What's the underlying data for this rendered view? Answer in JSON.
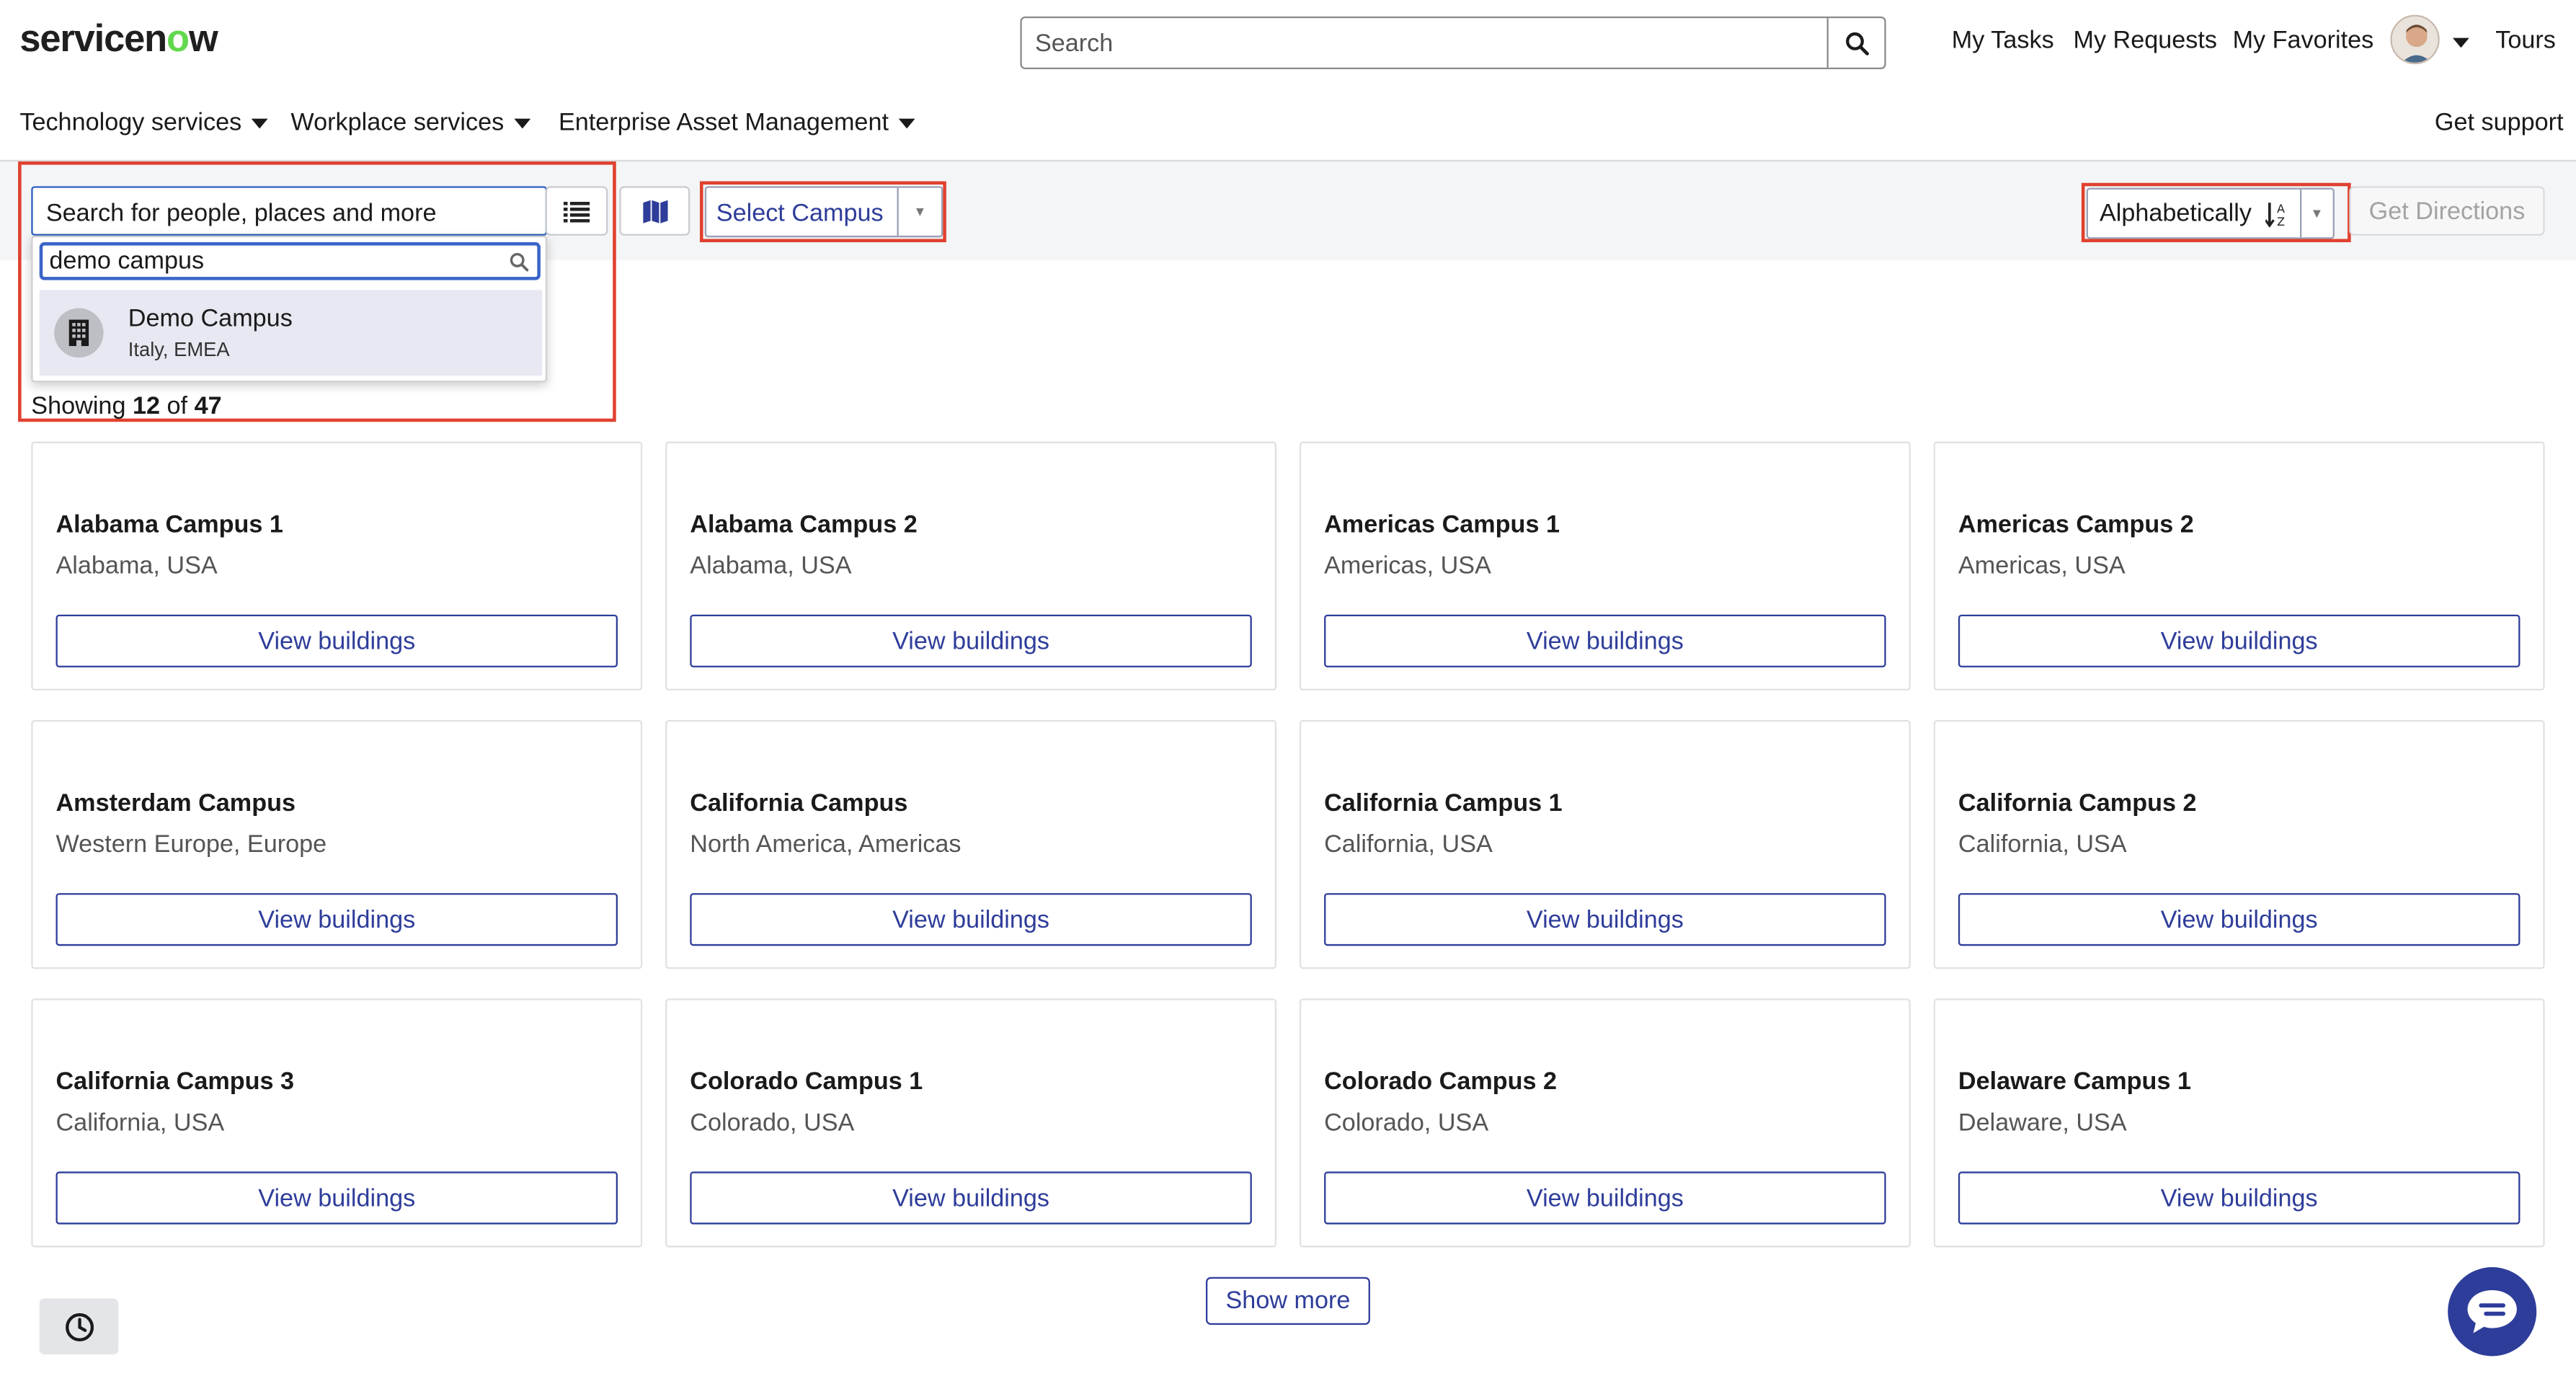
{
  "brand": {
    "name_prefix": "servicen",
    "name_o": "o",
    "name_suffix": "w",
    "accent_color": "#62d84e"
  },
  "header": {
    "search_placeholder": "Search",
    "nav": {
      "my_tasks": "My Tasks",
      "my_requests": "My Requests",
      "my_favorites": "My Favorites",
      "tours": "Tours"
    }
  },
  "menu": {
    "technology_services": "Technology services",
    "workplace_services": "Workplace services",
    "enterprise_asset_management": "Enterprise Asset Management",
    "get_support": "Get support"
  },
  "toolbar": {
    "people_search_placeholder": "Search for people, places and more",
    "select_campus": "Select Campus",
    "sort_label": "Alphabetically",
    "get_directions": "Get Directions"
  },
  "dropdown": {
    "query": "demo campus",
    "result": {
      "name": "Demo Campus",
      "location": "Italy, EMEA"
    }
  },
  "results": {
    "prefix": "Showing",
    "shown": "12",
    "of": "of",
    "total": "47"
  },
  "campuses": [
    {
      "name": "Alabama Campus 1",
      "location": "Alabama, USA",
      "button": "View buildings"
    },
    {
      "name": "Alabama Campus 2",
      "location": "Alabama, USA",
      "button": "View buildings"
    },
    {
      "name": "Americas Campus 1",
      "location": "Americas, USA",
      "button": "View buildings"
    },
    {
      "name": "Americas Campus 2",
      "location": "Americas, USA",
      "button": "View buildings"
    },
    {
      "name": "Amsterdam Campus",
      "location": "Western Europe, Europe",
      "button": "View buildings"
    },
    {
      "name": "California Campus",
      "location": "North America, Americas",
      "button": "View buildings"
    },
    {
      "name": "California Campus 1",
      "location": "California, USA",
      "button": "View buildings"
    },
    {
      "name": "California Campus 2",
      "location": "California, USA",
      "button": "View buildings"
    },
    {
      "name": "California Campus 3",
      "location": "California, USA",
      "button": "View buildings"
    },
    {
      "name": "Colorado Campus 1",
      "location": "Colorado, USA",
      "button": "View buildings"
    },
    {
      "name": "Colorado Campus 2",
      "location": "Colorado, USA",
      "button": "View buildings"
    },
    {
      "name": "Delaware Campus 1",
      "location": "Delaware, USA",
      "button": "View buildings"
    }
  ],
  "footer": {
    "show_more": "Show more"
  },
  "icons": [
    "search-icon",
    "avatar",
    "list-view-icon",
    "map-view-icon",
    "sort-az-icon",
    "building-icon",
    "history-icon",
    "chat-icon"
  ],
  "colors": {
    "primary": "#2e3d9a",
    "highlight_border": "#e0412f",
    "band": "#f4f5f7"
  }
}
